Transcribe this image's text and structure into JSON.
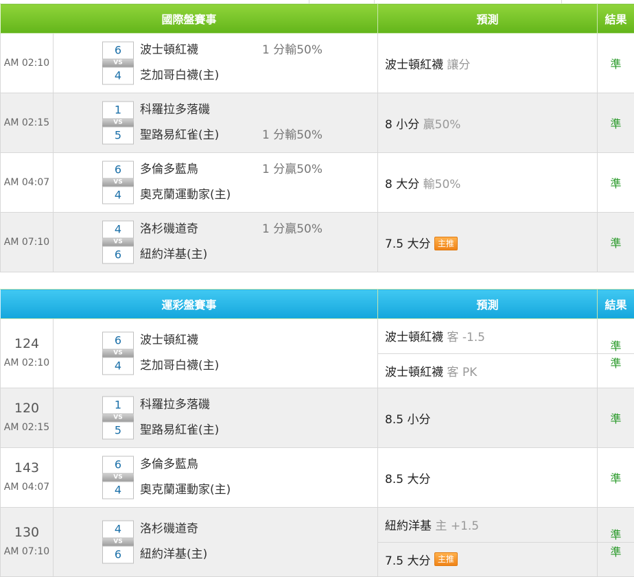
{
  "intl": {
    "header": {
      "title": "國際盤賽事",
      "prediction": "預測",
      "result": "結果"
    },
    "rows": [
      {
        "time": "AM 02:10",
        "away_score": "6",
        "home_score": "4",
        "vs": "VS",
        "away": "波士頓紅襪",
        "home": "芝加哥白襪(主)",
        "away_odds": "1 分輸50%",
        "home_odds": "",
        "pick": "波士頓紅襪",
        "pick_sub": "讓分",
        "tag": "",
        "result": "準"
      },
      {
        "time": "AM 02:15",
        "away_score": "1",
        "home_score": "5",
        "vs": "VS",
        "away": "科羅拉多落磯",
        "home": "聖路易紅雀(主)",
        "away_odds": "",
        "home_odds": "1 分輸50%",
        "pick": "8 小分",
        "pick_sub": "贏50%",
        "tag": "",
        "result": "準"
      },
      {
        "time": "AM 04:07",
        "away_score": "6",
        "home_score": "4",
        "vs": "VS",
        "away": "多倫多藍鳥",
        "home": "奧克蘭運動家(主)",
        "away_odds": "1 分贏50%",
        "home_odds": "",
        "pick": "8 大分",
        "pick_sub": "輸50%",
        "tag": "",
        "result": "準"
      },
      {
        "time": "AM 07:10",
        "away_score": "4",
        "home_score": "6",
        "vs": "VS",
        "away": "洛杉磯道奇",
        "home": "紐約洋基(主)",
        "away_odds": "1 分贏50%",
        "home_odds": "",
        "pick": "7.5 大分",
        "pick_sub": "",
        "tag": "主推",
        "result": "準"
      }
    ]
  },
  "lottery": {
    "header": {
      "title": "運彩盤賽事",
      "prediction": "預測",
      "result": "結果"
    },
    "rows": [
      {
        "num": "124",
        "time": "AM 02:10",
        "away_score": "6",
        "home_score": "4",
        "vs": "VS",
        "away": "波士頓紅襪",
        "home": "芝加哥白襪(主)",
        "pick1": "波士頓紅襪",
        "pick1_sub": "客 -1.5",
        "tag1": "",
        "result1": "準",
        "pick2": "波士頓紅襪",
        "pick2_sub": "客 PK",
        "tag2": "",
        "result2": "準"
      },
      {
        "num": "120",
        "time": "AM 02:15",
        "away_score": "1",
        "home_score": "5",
        "vs": "VS",
        "away": "科羅拉多落磯",
        "home": "聖路易紅雀(主)",
        "pick1": "8.5 小分",
        "pick1_sub": "",
        "result1": "準"
      },
      {
        "num": "143",
        "time": "AM 04:07",
        "away_score": "6",
        "home_score": "4",
        "vs": "VS",
        "away": "多倫多藍鳥",
        "home": "奧克蘭運動家(主)",
        "pick1": "8.5 大分",
        "pick1_sub": "",
        "result1": "準"
      },
      {
        "num": "130",
        "time": "AM 07:10",
        "away_score": "4",
        "home_score": "6",
        "vs": "VS",
        "away": "洛杉磯道奇",
        "home": "紐約洋基(主)",
        "pick1": "紐約洋基",
        "pick1_sub": "主 +1.5",
        "tag1": "",
        "result1": "準",
        "pick2": "7.5 大分",
        "pick2_sub": "",
        "tag2": "主推",
        "result2": "準"
      }
    ]
  }
}
